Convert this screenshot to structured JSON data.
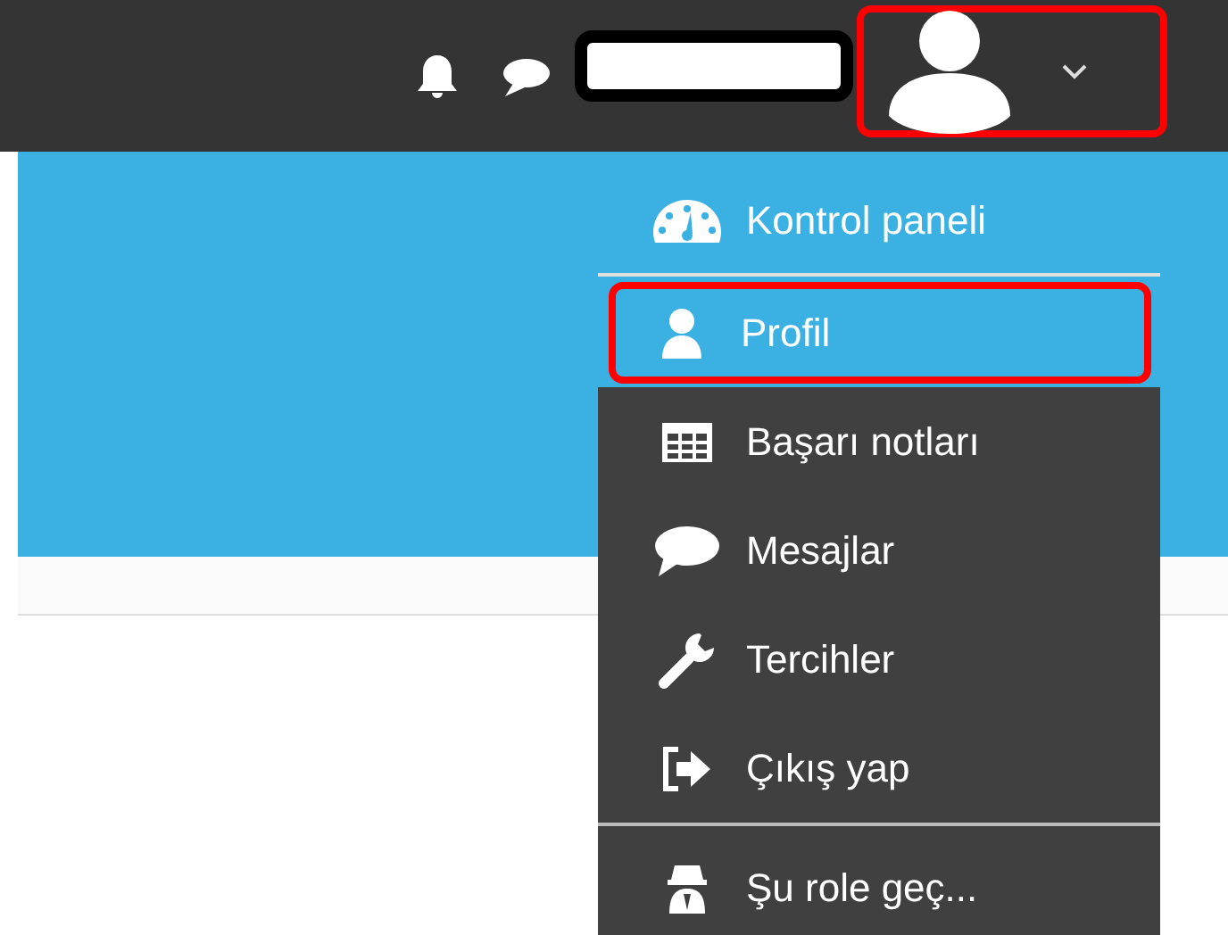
{
  "navbar": {
    "user_name_redacted": true,
    "user_menu_open": true,
    "user_menu_highlighted": true
  },
  "user_menu": {
    "items": [
      {
        "label": "Kontrol paneli",
        "kind": "clear",
        "selected": false,
        "divider_after": true
      },
      {
        "label": "Profil",
        "kind": "clear",
        "selected": true,
        "divider_after": false
      },
      {
        "label": "Başarı notları",
        "kind": "dark",
        "selected": false,
        "divider_after": false
      },
      {
        "label": "Mesajlar",
        "kind": "dark",
        "selected": false,
        "divider_after": false
      },
      {
        "label": "Tercihler",
        "kind": "dark",
        "selected": false,
        "divider_after": false
      },
      {
        "label": "Çıkış yap",
        "kind": "dark",
        "selected": false,
        "divider_after": true
      },
      {
        "label": "Şu role geç...",
        "kind": "dark",
        "selected": false,
        "divider_after": false
      }
    ]
  }
}
